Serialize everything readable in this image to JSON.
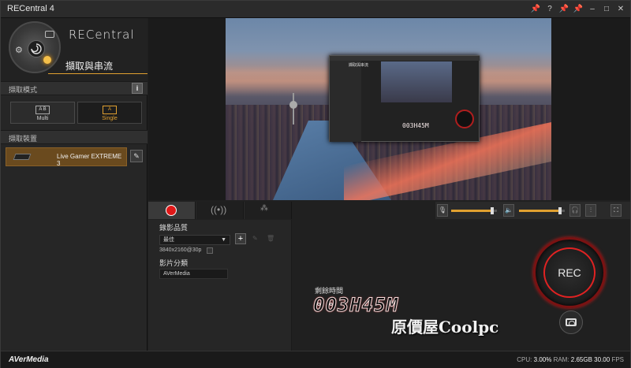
{
  "window": {
    "title": "RECentral 4",
    "controls": [
      "📌",
      "?",
      "📌",
      "📌",
      "–",
      "□",
      "✕"
    ]
  },
  "brand": {
    "name": "RECentral",
    "mode_title": "擷取與串流"
  },
  "capture_mode": {
    "header": "擷取模式",
    "info_label": "i",
    "multi": {
      "label": "Multi",
      "icon_text": "A B"
    },
    "single": {
      "label": "Single",
      "icon_text": "A"
    }
  },
  "capture_device": {
    "header": "擷取裝置",
    "device_name": "Live Gamer EXTREME 3"
  },
  "preview": {
    "mini_time": "003H45M",
    "mini_title": "擷取與串流"
  },
  "settings": {
    "quality_label": "錄影品質",
    "quality_value": "最佳",
    "resolution": "3840x2160@30p",
    "category_label": "影片分類",
    "category_value": "AVerMedia"
  },
  "recording": {
    "remaining_label": "剩餘時間",
    "counter": "003H45M",
    "rec_label": "REC"
  },
  "audio": {
    "mic_level": 0.9,
    "speaker_level": 0.9
  },
  "overlay": {
    "watermark": "原價屋Coolpc"
  },
  "status": {
    "logo": "AVerMedia",
    "cpu_label": "CPU:",
    "cpu_value": "3.00%",
    "ram_label": "RAM:",
    "ram_value": "2.65GB",
    "fps_value": "30.00",
    "fps_label": "FPS"
  }
}
